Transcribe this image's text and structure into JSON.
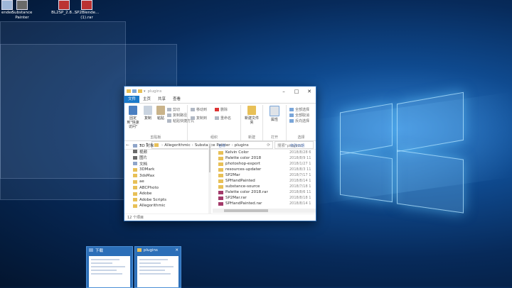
{
  "desktop": {
    "icons": [
      {
        "label": "ender",
        "icon": "app-icon"
      },
      {
        "label": "Substance Painter",
        "icon": "substance-painter-icon"
      },
      {
        "label": "BL2SP_2.8....",
        "icon": "archive-icon"
      },
      {
        "label": "SP2Blende... (1).rar",
        "icon": "archive-icon"
      }
    ]
  },
  "explorer": {
    "title": "plugins",
    "tabs": [
      "文件",
      "主页",
      "共享",
      "查看"
    ],
    "ribbon": {
      "groups": [
        {
          "label": "剪贴板"
        },
        {
          "label": "组织"
        },
        {
          "label": "新建"
        },
        {
          "label": "打开"
        },
        {
          "label": "选择"
        }
      ],
      "pin_label": "固定到\"快速访问\"",
      "copy_label": "复制",
      "paste_label": "粘贴",
      "cut_label": "剪切",
      "copy_path_label": "复制路径",
      "paste_shortcut_label": "粘贴快捷方式",
      "move_to_label": "移动到",
      "copy_to_label": "复制到",
      "delete_label": "删除",
      "rename_label": "重命名",
      "new_folder_label": "新建文件夹",
      "properties_label": "属性",
      "select_all_label": "全部选择",
      "select_none_label": "全部取消",
      "invert_selection_label": "反向选择"
    },
    "address": {
      "crumbs": [
        "Allegorithmic",
        "Substance Painter",
        "plugins"
      ],
      "search_placeholder": "搜索\"plugins\""
    },
    "nav_pane": [
      {
        "label": "3D 对象",
        "color": "#8fa5c9"
      },
      {
        "label": "视频",
        "color": "#6b6b6b"
      },
      {
        "label": "图片",
        "color": "#6b6b6b"
      },
      {
        "label": "文档",
        "color": "#8fa5c9"
      },
      {
        "label": "3DMark",
        "color": "#e8c057"
      },
      {
        "label": "3dsMax",
        "color": "#e8c057"
      },
      {
        "label": "ae",
        "color": "#e8c057"
      },
      {
        "label": "ABCPhoto",
        "color": "#e8c057"
      },
      {
        "label": "Adobe",
        "color": "#e8c057"
      },
      {
        "label": "Adobe Scripts",
        "color": "#e8c057"
      },
      {
        "label": "Allegorithmic",
        "color": "#e8c057"
      }
    ],
    "columns": {
      "name": "名称",
      "date": "修改日期"
    },
    "files": [
      {
        "name": "Kelvin Color",
        "date": "2018/8/28 6",
        "type": "folder"
      },
      {
        "name": "Palette color 2018",
        "date": "2018/8/9 11",
        "type": "folder"
      },
      {
        "name": "photoshop-export",
        "date": "2018/1/27 1",
        "type": "folder"
      },
      {
        "name": "resources-updater",
        "date": "2018/8/3 11",
        "type": "folder"
      },
      {
        "name": "SP2Mar",
        "date": "2018/7/17 1",
        "type": "folder"
      },
      {
        "name": "SPHandPainted",
        "date": "2018/8/14 1",
        "type": "folder"
      },
      {
        "name": "substance-source",
        "date": "2018/7/18 1",
        "type": "folder"
      },
      {
        "name": "Palette color 2018.rar",
        "date": "2018/8/6 11",
        "type": "rar"
      },
      {
        "name": "SP2Mar.rar",
        "date": "2018/8/18 1",
        "type": "rar"
      },
      {
        "name": "SPHandPainted.rar",
        "date": "2018/8/14 1",
        "type": "rar"
      }
    ],
    "status": "12 个项目"
  },
  "taskbar_previews": [
    {
      "label": "下载",
      "icon": "download-icon"
    },
    {
      "label": "plugins",
      "icon": "folder-icon",
      "close": "✕"
    }
  ],
  "colors": {
    "accent": "#1979ca",
    "folder": "#e8c057",
    "desktop": "#0f4a8f"
  }
}
